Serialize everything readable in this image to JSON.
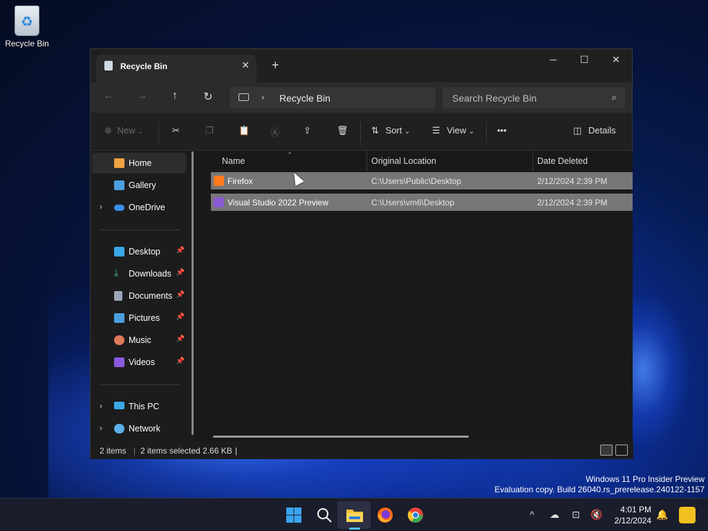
{
  "desktop": {
    "icon_label": "Recycle Bin",
    "watermark_line1": "Windows 11 Pro Insider Preview",
    "watermark_line2": "Evaluation copy. Build 26040.rs_prerelease.240122-1157"
  },
  "window": {
    "tab_title": "Recycle Bin",
    "tab_close": "✕",
    "new_tab": "+",
    "controls": {
      "minimize": "─",
      "maximize": "☐",
      "close": "✕"
    }
  },
  "navbar": {
    "back": "←",
    "forward": "→",
    "up": "↑",
    "refresh": "↻",
    "breadcrumb_sep": "›",
    "breadcrumb": "Recycle Bin",
    "search_placeholder": "Search Recycle Bin",
    "search_icon": "⌕"
  },
  "toolbar": {
    "new_label": "New",
    "sort_label": "Sort",
    "view_label": "View",
    "more_label": "•••",
    "details_label": "Details",
    "chevron": "⌄"
  },
  "sidebar": {
    "items": [
      {
        "label": "Home",
        "icon": "home-icon",
        "color": "#f0a340"
      },
      {
        "label": "Gallery",
        "icon": "gallery-icon",
        "color": "#4a9fe0"
      },
      {
        "label": "OneDrive",
        "icon": "onedrive-icon",
        "color": "#3a8fe8"
      },
      {
        "label": "Desktop",
        "icon": "desktop-icon",
        "color": "#3aa8e8"
      },
      {
        "label": "Downloads",
        "icon": "downloads-icon",
        "color": "#3cc08a"
      },
      {
        "label": "Documents",
        "icon": "documents-icon",
        "color": "#9aa6b8"
      },
      {
        "label": "Pictures",
        "icon": "pictures-icon",
        "color": "#4a9fe0"
      },
      {
        "label": "Music",
        "icon": "music-icon",
        "color": "#e07a5a"
      },
      {
        "label": "Videos",
        "icon": "videos-icon",
        "color": "#8a5ae0"
      },
      {
        "label": "This PC",
        "icon": "this-pc-icon",
        "color": "#3aa8e8"
      },
      {
        "label": "Network",
        "icon": "network-icon",
        "color": "#5ab0e8"
      }
    ],
    "expand_glyph": "›",
    "pin_glyph": "📌"
  },
  "columns": [
    "Name",
    "Original Location",
    "Date Deleted"
  ],
  "sort_caret": "^",
  "rows": [
    {
      "name": "Firefox",
      "location": "C:\\Users\\Public\\Desktop",
      "date": "2/12/2024 2:39 PM",
      "icon": "firefox-icon",
      "color": "#ff7a1a"
    },
    {
      "name": "Visual Studio 2022 Preview",
      "location": "C:\\Users\\vm6\\Desktop",
      "date": "2/12/2024 2:39 PM",
      "icon": "visual-studio-icon",
      "color": "#8a5ad0"
    }
  ],
  "status": {
    "items": "2 items",
    "selected": "2 items selected  2.66 KB",
    "separator": "|"
  },
  "taskbar": {
    "time": "4:01 PM",
    "date": "2/12/2024",
    "tray_chevron": "^"
  }
}
